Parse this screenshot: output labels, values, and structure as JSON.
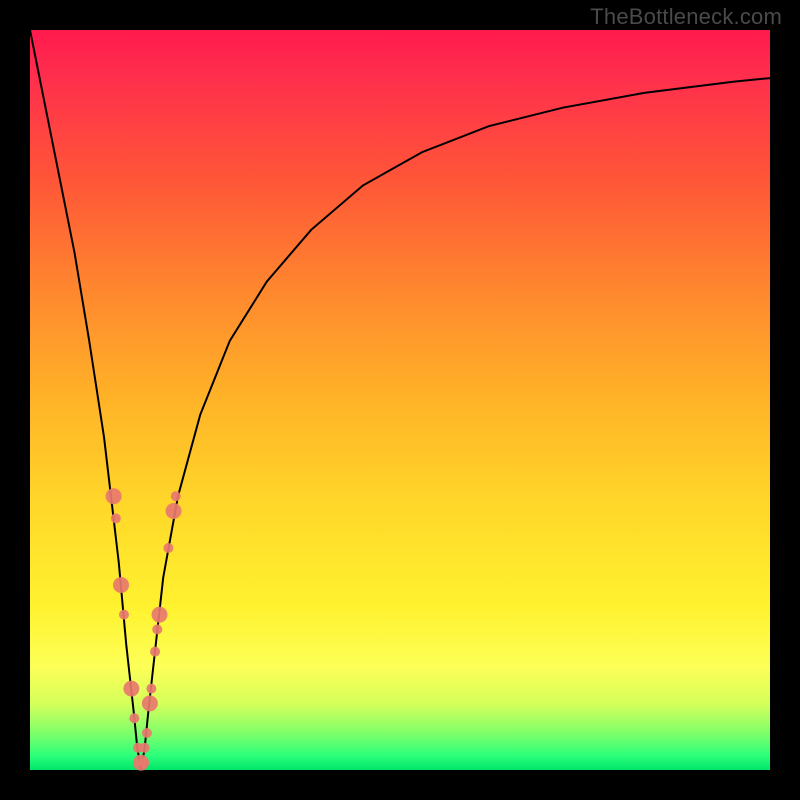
{
  "watermark": "TheBottleneck.com",
  "chart_data": {
    "type": "line",
    "title": "",
    "xlabel": "",
    "ylabel": "",
    "xlim": [
      0,
      100
    ],
    "ylim": [
      0,
      100
    ],
    "x": [
      0,
      2,
      4,
      6,
      8,
      10,
      12,
      13,
      14,
      14.5,
      15,
      15.5,
      16,
      17,
      18,
      20,
      23,
      27,
      32,
      38,
      45,
      53,
      62,
      72,
      83,
      95,
      100
    ],
    "y": [
      100,
      90,
      80,
      70,
      58,
      45,
      28,
      17,
      8,
      3,
      0,
      3,
      8,
      17,
      26,
      37,
      48,
      58,
      66,
      73,
      79,
      83.5,
      87,
      89.5,
      91.5,
      93,
      93.5
    ],
    "series": [
      {
        "name": "bottleneck-curve",
        "stroke": "#000000",
        "stroke_width": 2
      }
    ],
    "scatter": {
      "name": "data-points",
      "color": "#e8786e",
      "radius_small": 5,
      "radius_large": 8,
      "points": [
        {
          "x": 11.3,
          "y": 37,
          "r": "large"
        },
        {
          "x": 11.6,
          "y": 34,
          "r": "small"
        },
        {
          "x": 12.3,
          "y": 25,
          "r": "large"
        },
        {
          "x": 12.7,
          "y": 21,
          "r": "small"
        },
        {
          "x": 13.7,
          "y": 11,
          "r": "large"
        },
        {
          "x": 14.1,
          "y": 7,
          "r": "small"
        },
        {
          "x": 14.6,
          "y": 3,
          "r": "small"
        },
        {
          "x": 15.0,
          "y": 1,
          "r": "large"
        },
        {
          "x": 15.3,
          "y": 1,
          "r": "small"
        },
        {
          "x": 15.5,
          "y": 3,
          "r": "small"
        },
        {
          "x": 15.8,
          "y": 5,
          "r": "small"
        },
        {
          "x": 16.2,
          "y": 9,
          "r": "large"
        },
        {
          "x": 16.4,
          "y": 11,
          "r": "small"
        },
        {
          "x": 16.9,
          "y": 16,
          "r": "small"
        },
        {
          "x": 17.2,
          "y": 19,
          "r": "small"
        },
        {
          "x": 17.5,
          "y": 21,
          "r": "large"
        },
        {
          "x": 18.7,
          "y": 30,
          "r": "small"
        },
        {
          "x": 19.4,
          "y": 35,
          "r": "large"
        },
        {
          "x": 19.7,
          "y": 37,
          "r": "small"
        }
      ]
    }
  }
}
